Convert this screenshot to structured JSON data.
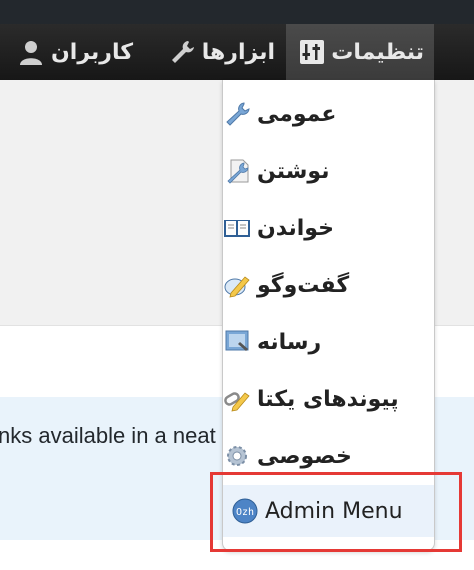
{
  "menubar": {
    "items": [
      {
        "label": "کاربران",
        "icon": "user-icon"
      },
      {
        "label": "ابزارها",
        "icon": "wrench-icon"
      },
      {
        "label": "تنظیمات",
        "icon": "settings-icon",
        "active": true
      }
    ]
  },
  "dropdown": {
    "items": [
      {
        "label": "عمومی",
        "icon": "wrench-icon"
      },
      {
        "label": "نوشتن",
        "icon": "writing-icon"
      },
      {
        "label": "خواندن",
        "icon": "book-icon"
      },
      {
        "label": "گفت‌وگو",
        "icon": "pencil-icon"
      },
      {
        "label": "رسانه",
        "icon": "media-icon"
      },
      {
        "label": "پیوندهای یکتا",
        "icon": "link-icon"
      },
      {
        "label": "خصوصی",
        "icon": "gear-icon"
      },
      {
        "label": "Admin Menu",
        "icon": "ozh-logo-icon",
        "highlighted": true
      }
    ]
  },
  "notice": {
    "text": "nks available in a neat horizontal drop dov"
  },
  "colors": {
    "menubar": "#222222",
    "dropdown_bg": "#ffffff",
    "highlight_border": "#e53935",
    "notice_bg": "#e9f3fb"
  }
}
